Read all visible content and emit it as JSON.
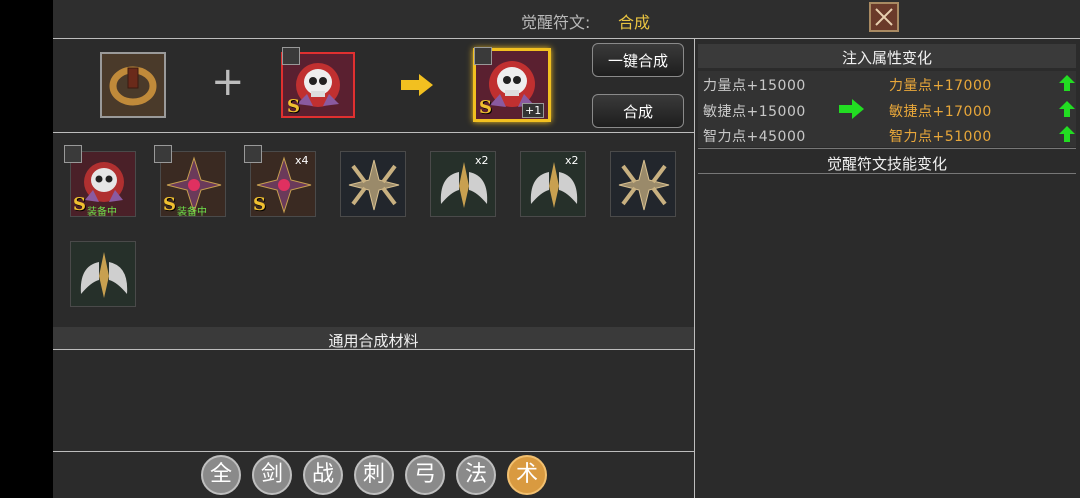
{
  "header": {
    "title_label": "觉醒符文:",
    "title_value": "合成",
    "close_icon": "close-x-icon"
  },
  "craft": {
    "one_key_label": "一键合成",
    "compose_label": "合成",
    "result_level": "+1",
    "rank": "S"
  },
  "inventory": {
    "items": [
      {
        "name": "skull-rune",
        "rank": "S",
        "status": "装备中",
        "count": ""
      },
      {
        "name": "star-rune",
        "rank": "S",
        "status": "装备中",
        "count": ""
      },
      {
        "name": "star-rune",
        "rank": "S",
        "status": "",
        "count": "x4"
      },
      {
        "name": "cross-rune",
        "rank": "",
        "status": "",
        "count": ""
      },
      {
        "name": "wing-rune",
        "rank": "",
        "status": "",
        "count": "x2"
      },
      {
        "name": "wing-rune",
        "rank": "",
        "status": "",
        "count": "x2"
      },
      {
        "name": "cross-rune",
        "rank": "",
        "status": "",
        "count": ""
      },
      {
        "name": "wing-rune",
        "rank": "",
        "status": "",
        "count": ""
      }
    ]
  },
  "materials": {
    "title": "通用合成材料"
  },
  "tabs": [
    "全",
    "剑",
    "战",
    "刺",
    "弓",
    "法",
    "术"
  ],
  "active_tab": "术",
  "attributes": {
    "title": "注入属性变化",
    "rows": [
      {
        "before": "力量点+15000",
        "after": "力量点+17000"
      },
      {
        "before": "敏捷点+15000",
        "after": "敏捷点+17000"
      },
      {
        "before": "智力点+45000",
        "after": "智力点+51000"
      }
    ]
  },
  "skills": {
    "title": "觉醒符文技能变化"
  },
  "colors": {
    "accent": "#e8c341",
    "up_arrow": "#22cc22",
    "increase": "#e8a73a"
  }
}
